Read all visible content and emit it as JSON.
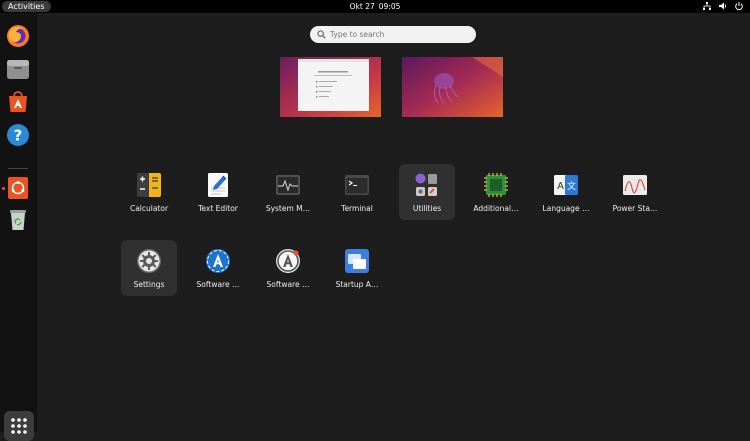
{
  "topbar": {
    "activities": "Activities",
    "date": "Okt 27",
    "time": "09:05"
  },
  "search": {
    "placeholder": "Type to search"
  },
  "apps": [
    {
      "label": "Calculator",
      "icon": "calculator-icon"
    },
    {
      "label": "Text Editor",
      "icon": "text-editor-icon"
    },
    {
      "label": "System M…",
      "icon": "system-monitor-icon"
    },
    {
      "label": "Terminal",
      "icon": "terminal-icon"
    },
    {
      "label": "Utilities",
      "icon": "utilities-folder-icon"
    },
    {
      "label": "Additional…",
      "icon": "additional-drivers-icon"
    },
    {
      "label": "Language …",
      "icon": "language-support-icon"
    },
    {
      "label": "Power Sta…",
      "icon": "power-statistics-icon"
    },
    {
      "label": "Settings",
      "icon": "settings-icon"
    },
    {
      "label": "Software …",
      "icon": "software-updater-icon"
    },
    {
      "label": "Software …",
      "icon": "software-properties-icon"
    },
    {
      "label": "Startup A…",
      "icon": "startup-applications-icon"
    }
  ],
  "dock": [
    "firefox-icon",
    "files-icon",
    "app-center-icon",
    "help-icon",
    "ubuntu-installer-icon",
    "trash-icon"
  ],
  "colors": {
    "accent": "#e95420",
    "background": "#1d1d1d",
    "panel": "#000000"
  }
}
